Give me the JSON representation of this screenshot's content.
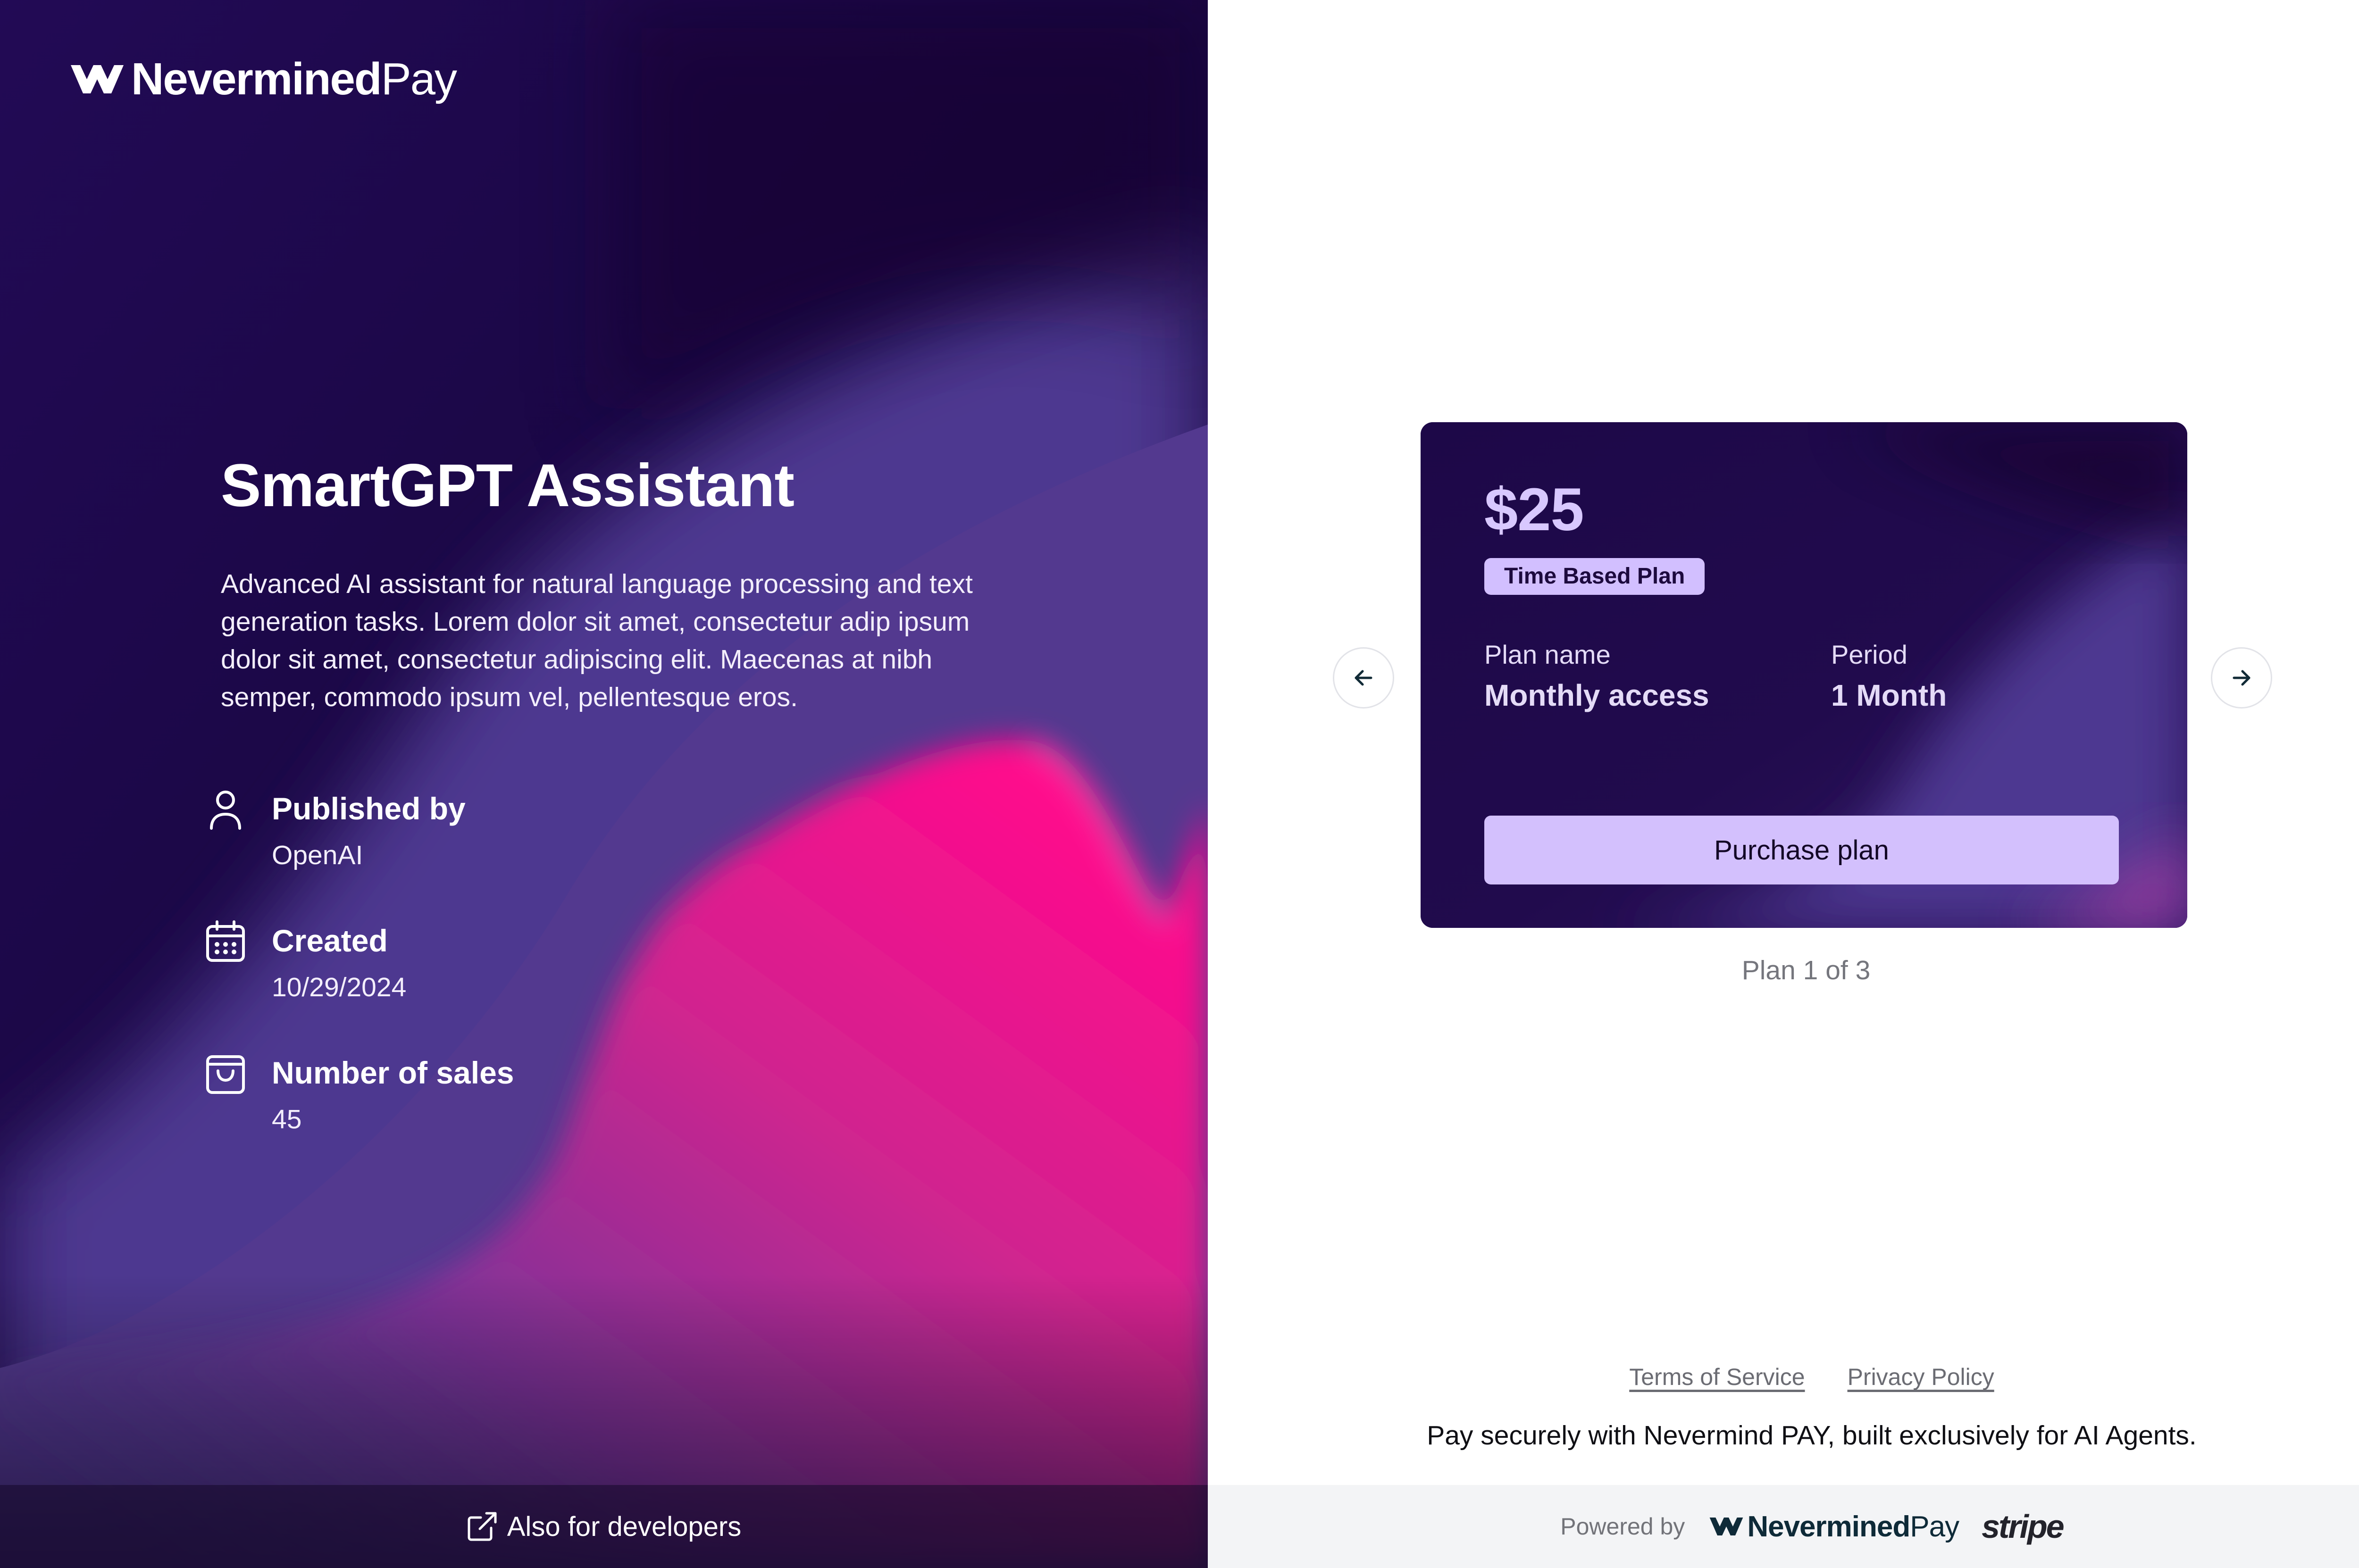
{
  "brand": {
    "name_bold": "Nevermined",
    "name_light": "Pay"
  },
  "product": {
    "title": "SmartGPT Assistant",
    "description": "Advanced AI assistant for natural language processing and text generation tasks. Lorem dolor sit amet, consectetur adip ipsum dolor sit amet, consectetur adipiscing elit. Maecenas at nibh semper, commodo ipsum vel, pellentesque eros."
  },
  "meta": [
    {
      "icon": "user-icon",
      "label": "Published by",
      "value": "OpenAI"
    },
    {
      "icon": "calendar-icon",
      "label": "Created",
      "value": "10/29/2024"
    },
    {
      "icon": "shopping-bag-icon",
      "label": "Number of sales",
      "value": "45"
    }
  ],
  "developers_link": {
    "icon": "external-link-icon",
    "label": "Also for developers"
  },
  "plan": {
    "price": "$25",
    "badge": "Time Based Plan",
    "name_label": "Plan name",
    "name_value": "Monthly access",
    "period_label": "Period",
    "period_value": "1 Month",
    "purchase_label": "Purchase plan",
    "counter": "Plan 1 of 3"
  },
  "carousel": {
    "prev_icon": "arrow-left-icon",
    "next_icon": "arrow-right-icon"
  },
  "footer": {
    "terms": "Terms of Service",
    "privacy": "Privacy Policy",
    "tagline": "Pay securely with Nevermind PAY, built exclusively for AI Agents.",
    "powered_by": "Powered by",
    "stripe": "stripe"
  },
  "colors": {
    "left_bg_dark": "#1a0645",
    "purple": "#51398f",
    "pink": "#f20a8f",
    "badge": "#d2bfff",
    "button": "#d3c0fd",
    "footer_bg": "#f3f4f6"
  }
}
